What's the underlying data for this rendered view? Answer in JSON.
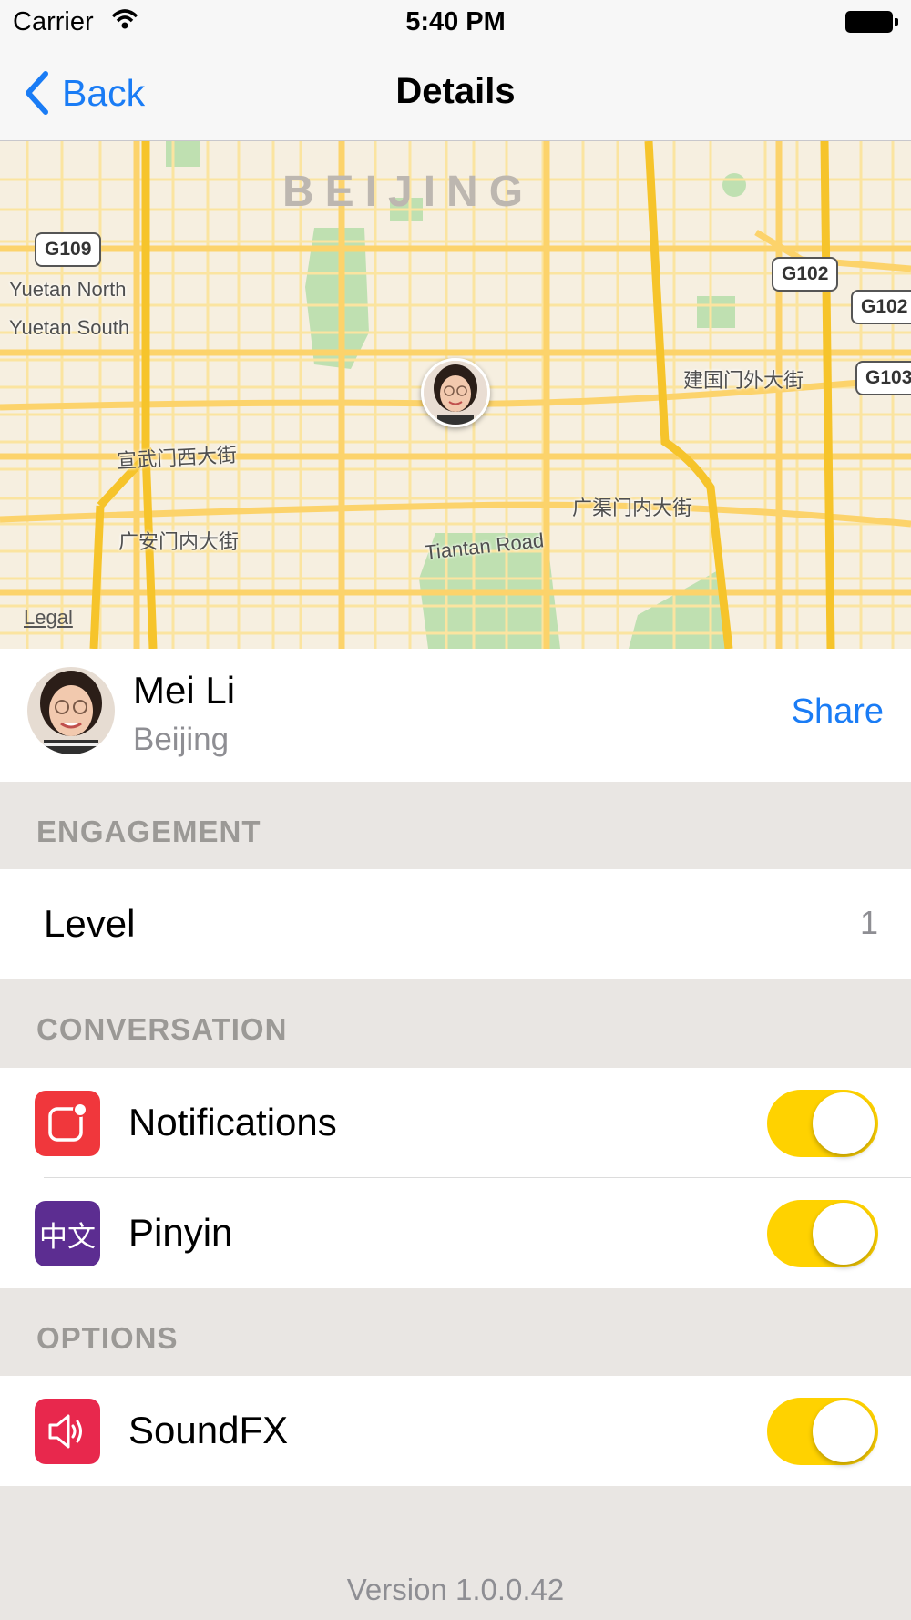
{
  "status_bar": {
    "carrier": "Carrier",
    "time": "5:40 PM"
  },
  "nav": {
    "back_label": "Back",
    "title": "Details"
  },
  "map": {
    "city_label": "BEIJING",
    "labels": [
      "Yuetan North",
      "Yuetan South",
      "宣武门西大街",
      "广安门内大街",
      "建国门外大街",
      "广渠门内大街",
      "Tiantan Road"
    ],
    "shields": [
      "G109",
      "G102",
      "G102",
      "G103"
    ],
    "legal": "Legal"
  },
  "profile": {
    "name": "Mei Li",
    "city": "Beijing",
    "share_label": "Share"
  },
  "engagement": {
    "header": "ENGAGEMENT",
    "level_label": "Level",
    "level_value": "1"
  },
  "conversation": {
    "header": "CONVERSATION",
    "items": [
      {
        "label": "Notifications",
        "icon": "notification-badge-icon",
        "enabled": true,
        "color": "#f0373c"
      },
      {
        "label": "Pinyin",
        "icon": "chinese-text-icon",
        "icon_text": "中文",
        "enabled": true,
        "color": "#5c2d91"
      }
    ]
  },
  "options": {
    "header": "OPTIONS",
    "items": [
      {
        "label": "SoundFX",
        "icon": "speaker-icon",
        "enabled": true,
        "color": "#e8284d"
      }
    ]
  },
  "footer": {
    "version": "Version 1.0.0.42"
  },
  "colors": {
    "accent": "#1a7cf5",
    "toggle_on": "#ffd200",
    "grouped_bg": "#e9e6e3"
  }
}
